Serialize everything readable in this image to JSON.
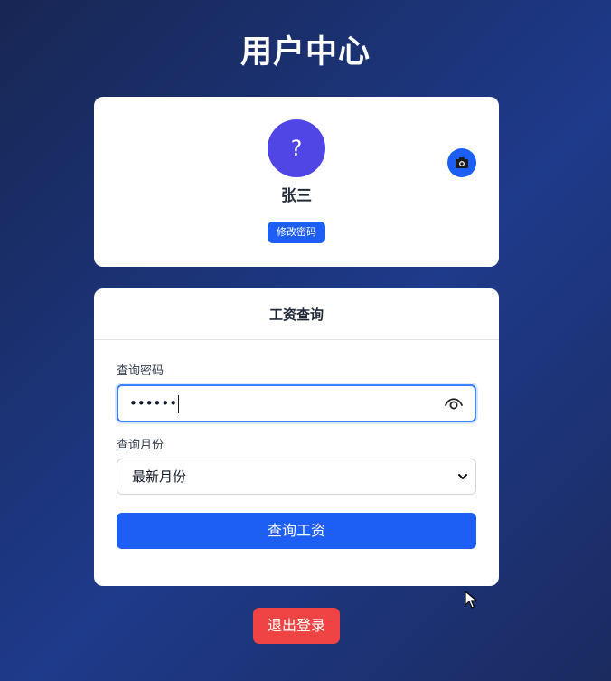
{
  "page": {
    "title": "用户中心"
  },
  "profile": {
    "avatar_text": "?",
    "name": "张三",
    "change_password_label": "修改密码",
    "camera_icon": "camera-icon"
  },
  "salary_query": {
    "header": "工资查询",
    "password_label": "查询密码",
    "password_value": "••••••",
    "password_toggle_icon": "eye-icon",
    "month_label": "查询月份",
    "month_selected": "最新月份",
    "submit_label": "查询工资"
  },
  "logout_label": "退出登录",
  "colors": {
    "primary": "#1d5ef5",
    "avatar": "#4f46e5",
    "danger": "#ef4444",
    "background": "#1e3a8a"
  }
}
